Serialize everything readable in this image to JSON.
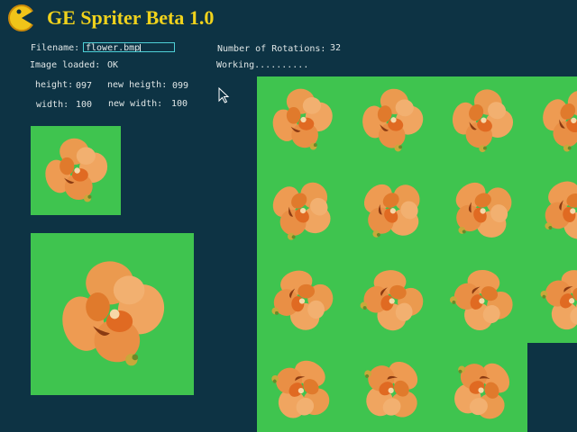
{
  "app": {
    "title": "GE Spriter Beta 1.0"
  },
  "form": {
    "filename_label": "Filename:",
    "filename_value": "flower.bmp",
    "image_loaded_label": "Image loaded:",
    "image_loaded_value": "OK",
    "height_label": "height:",
    "height_value": "097",
    "new_height_label": "new heigth:",
    "new_height_value": "099",
    "width_label": "width:",
    "width_value": "100",
    "new_width_label": "new width:",
    "new_width_value": "100",
    "rotations_label": "Number of Rotations:",
    "rotations_value": "32",
    "status": "Working.........."
  },
  "colors": {
    "background": "#0d3344",
    "sprite_background": "#3fc44f",
    "title": "#f0d21c",
    "flower": "#ee9a4e"
  },
  "sprite_sheet": {
    "columns": 4,
    "visible_rows": 4,
    "flower_color": "#ee9a4e"
  }
}
